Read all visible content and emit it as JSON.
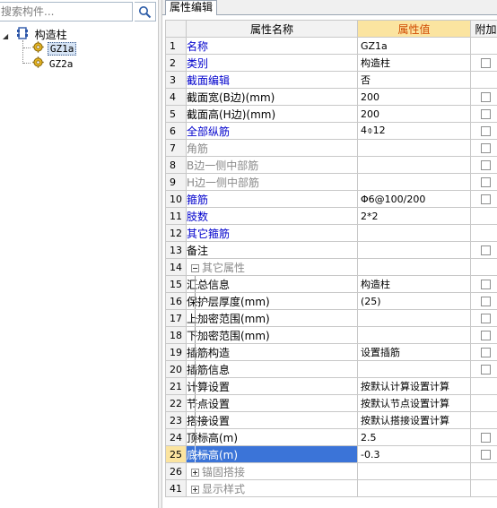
{
  "search": {
    "placeholder": "搜索构件..."
  },
  "tree": {
    "root_label": "构造柱",
    "children": [
      {
        "label": "GZ1a",
        "selected": true
      },
      {
        "label": "GZ2a",
        "selected": false
      }
    ]
  },
  "tabs": [
    {
      "label": "属性编辑",
      "active": true
    }
  ],
  "grid": {
    "headers": {
      "num": "",
      "name": "属性名称",
      "value": "属性值",
      "add": "附加"
    },
    "rows": [
      {
        "num": "1",
        "name": "名称",
        "value": "GZ1a",
        "color": "blue",
        "level": 0,
        "checkbox": false
      },
      {
        "num": "2",
        "name": "类别",
        "value": "构造柱",
        "color": "blue",
        "level": 0,
        "checkbox": true
      },
      {
        "num": "3",
        "name": "截面编辑",
        "value": "否",
        "color": "blue",
        "level": 0,
        "checkbox": false
      },
      {
        "num": "4",
        "name": "截面宽(B边)(mm)",
        "value": "200",
        "color": "black",
        "level": 0,
        "checkbox": true
      },
      {
        "num": "5",
        "name": "截面高(H边)(mm)",
        "value": "200",
        "color": "black",
        "level": 0,
        "checkbox": true
      },
      {
        "num": "6",
        "name": "全部纵筋",
        "value": "4⌽12",
        "color": "blue",
        "level": 0,
        "checkbox": true
      },
      {
        "num": "7",
        "name": "角筋",
        "value": "",
        "color": "gray",
        "level": 0,
        "checkbox": true
      },
      {
        "num": "8",
        "name": "B边一侧中部筋",
        "value": "",
        "color": "gray",
        "level": 0,
        "checkbox": true
      },
      {
        "num": "9",
        "name": "H边一侧中部筋",
        "value": "",
        "color": "gray",
        "level": 0,
        "checkbox": true
      },
      {
        "num": "10",
        "name": "箍筋",
        "value": "Φ6@100/200",
        "color": "blue",
        "level": 0,
        "checkbox": true
      },
      {
        "num": "11",
        "name": "肢数",
        "value": "2*2",
        "color": "blue",
        "level": 0,
        "checkbox": false
      },
      {
        "num": "12",
        "name": "其它箍筋",
        "value": "",
        "color": "blue",
        "level": 0,
        "checkbox": false
      },
      {
        "num": "13",
        "name": "备注",
        "value": "",
        "color": "black",
        "level": 0,
        "checkbox": true
      },
      {
        "num": "14",
        "name": "其它属性",
        "value": "",
        "color": "gray",
        "level": -1,
        "expander": "minus",
        "checkbox": false
      },
      {
        "num": "15",
        "name": "汇总信息",
        "value": "构造柱",
        "color": "black",
        "level": 1,
        "checkbox": true
      },
      {
        "num": "16",
        "name": "保护层厚度(mm)",
        "value": "(25)",
        "color": "black",
        "level": 1,
        "checkbox": true
      },
      {
        "num": "17",
        "name": "上加密范围(mm)",
        "value": "",
        "color": "black",
        "level": 1,
        "checkbox": true
      },
      {
        "num": "18",
        "name": "下加密范围(mm)",
        "value": "",
        "color": "black",
        "level": 1,
        "checkbox": true
      },
      {
        "num": "19",
        "name": "插筋构造",
        "value": "设置插筋",
        "color": "black",
        "level": 1,
        "checkbox": true
      },
      {
        "num": "20",
        "name": "插筋信息",
        "value": "",
        "color": "black",
        "level": 1,
        "checkbox": true
      },
      {
        "num": "21",
        "name": "计算设置",
        "value": "按默认计算设置计算",
        "color": "black",
        "level": 1,
        "checkbox": false
      },
      {
        "num": "22",
        "name": "节点设置",
        "value": "按默认节点设置计算",
        "color": "black",
        "level": 1,
        "checkbox": false
      },
      {
        "num": "23",
        "name": "搭接设置",
        "value": "按默认搭接设置计算",
        "color": "black",
        "level": 1,
        "checkbox": false
      },
      {
        "num": "24",
        "name": "顶标高(m)",
        "value": "2.5",
        "color": "black",
        "level": 1,
        "checkbox": true
      },
      {
        "num": "25",
        "name": "底标高(m)",
        "value": "-0.3",
        "color": "black",
        "level": 1,
        "checkbox": true,
        "active": true
      },
      {
        "num": "26",
        "name": "锚固搭接",
        "value": "",
        "color": "gray",
        "level": -1,
        "expander": "plus",
        "checkbox": false
      },
      {
        "num": "41",
        "name": "显示样式",
        "value": "",
        "color": "gray",
        "level": -1,
        "expander": "plus",
        "checkbox": false
      }
    ]
  },
  "colors": {
    "header_value_bg": "#fbe4a0",
    "header_value_text": "#d04a00",
    "blue_name": "#0000cc",
    "gray_name": "#8a8a8a",
    "selection": "#3b74d8"
  }
}
